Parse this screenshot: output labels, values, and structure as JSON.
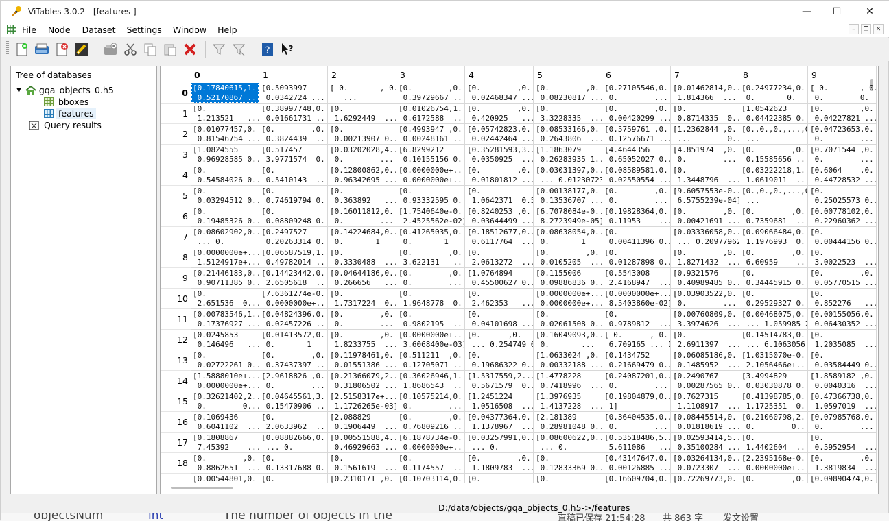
{
  "window": {
    "title": "ViTables 3.0.2 - [features     ]",
    "minimize": "—",
    "maximize": "☐",
    "close": "✕"
  },
  "menu": {
    "items": [
      "File",
      "Node",
      "Dataset",
      "Settings",
      "Window",
      "Help"
    ],
    "accel": [
      "F",
      "N",
      "D",
      "S",
      "W",
      "H"
    ]
  },
  "mdi_controls": {
    "minimize": "–",
    "restore": "❐",
    "close": "✕"
  },
  "toolbar": {
    "icons": [
      "new-file-icon",
      "open-file-icon",
      "close-file-icon",
      "edit-icon",
      "new-group-icon",
      "cut-icon",
      "copy-icon",
      "paste-icon",
      "delete-icon",
      "filter-icon",
      "filter-clear-icon",
      "help-icon",
      "whats-this-icon"
    ]
  },
  "tree": {
    "header": "Tree of databases",
    "file": "gqa_objects_0.h5",
    "children": [
      "bboxes",
      "features"
    ],
    "query": "Query results"
  },
  "table": {
    "columns": [
      "0",
      "1",
      "2",
      "3",
      "4",
      "5",
      "6",
      "7",
      "8",
      "9"
    ],
    "rows": [
      "0",
      "1",
      "2",
      "3",
      "4",
      "5",
      "6",
      "7",
      "8",
      "9",
      "10",
      "11",
      "12",
      "13",
      "14",
      "15",
      "16",
      "17",
      "18"
    ],
    "cells": [
      [
        "[0.17840615,1...\n 0.52170867 ...",
        "[0.5093997\n 0.0342724 ...",
        "[ 0.       , 0.\n   ...",
        "[0.        ,0.\n 0.39729667 ......",
        "[0.        ,0.\n 0.02468347 ......",
        "[0.        ,0.\n 0.08230817 ......",
        "[0.27105546,0.\n 0.        ...",
        "[0.01462814,0....\n 1.814366  ...",
        "[0.24977234,0....\n 0.       0.   ...",
        "[ 0.       , 0.\n 0.        0.   ..."
      ],
      [
        "[0.\n 1.213521   ...",
        "[0.38997748,0.\n 0.01661731 ......",
        "[0.\n 1.6292449  ...",
        "[0.01026754,1...\n 0.6172588  ...",
        "[0.        ,0.\n 0.420925   ...",
        "[0.\n 3.3228335  ...",
        "[0.        ,0.\n 0.00420299 ......",
        "[0.\n 0.8714335  0....",
        "[1.0542623\n 0.04422385 0....",
        "[0.        ,0.\n 0.04227821 ..."
      ],
      [
        "[0.01077457,0.\n 0.81546754 ......",
        "[0.        ,0.\n 0.3824439  ......",
        "[0.\n 0.00213907 0....",
        "[0.4993947 ,0.\n 0.00248161 ......",
        "[0.05742823,0.\n 0.02442464 ......",
        "[0.08533166,0.\n 0.2643806  ......",
        "[0.5759761 ,0.\n 0.12576671 ......",
        "[1.2362844 ,0.\n ...        0....",
        "[0.,0.,0.,...,0.,0.,\n ...",
        "[0.04723653,0.\n 0.        ..."
      ],
      [
        "[1.0824555\n 0.96928585 0....",
        "[0.517457\n 3.9771574  0....",
        "[0.03202028,4...\n 0.        ... 0.",
        "[6.8299212\n 0.10155156 0....",
        "[0.35281593,3...\n 0.0350925  ...",
        "[1.1863079\n 0.26283935 1....",
        "[4.4644356\n 0.65052027 0....",
        "[4.851974  ,0.\n 0.        ... 0....",
        "[0.        ,0.\n 0.15585656 ......",
        "[0.7071544 ,0.\n 0.        ..."
      ],
      [
        "[0.\n 0.54584026 0....",
        "[0.\n 0.5410143  ...",
        "[0.12800862,0....\n 0.96342695 ......",
        "[0.0000000e+...\n 0.0000000e+...",
        "[0.        ,0.\n 0.01801812 ......",
        "[0.03031397,0....\n ... 0.01230723...",
        "[0.08589581,0.\n 0.02550554 ......",
        "[0.\n 1.3448796  ...",
        "[0.03222218,1...\n 1.0619011  ...",
        "[0.6064    ,0.\n 0.44728532 ..."
      ],
      [
        "[0.\n 0.03294512 0....",
        "[0.\n 0.74619794 0....",
        "[0.\n 0.363892   ...",
        "[0.\n 0.93332595 0....",
        "[0.\n 1.0642371  0.5...",
        "[0.00138177,0.\n 0.13536707 ......",
        "[0.        ,0.\n 0.        ... 0....",
        "[9.6057553e-0...\n 6.5755239e-04]",
        "[0.,0.,0.,...,0.,0.,\n ...",
        "[0.\n 0.25025573 0..."
      ],
      [
        "[0.\n 0.19485326 0....",
        "[0.\n 0.08809248 0....",
        "[0.16011812,0.\n 0.        ...",
        "[1.7540640e-0...\n 2.4525562e-02]",
        "[0.8240253 ,0.\n 0.03644499 ......",
        "[6.7078084e-0...\n 8.2723949e-05]",
        "[0.19828364,0.\n 0.11953    ......",
        "[0.        ,0.\n 0.00421691 ......",
        "[0.        ,0.\n 0.7359681  ...",
        "[0.00778102,0.\n 0.22960362 ..."
      ],
      [
        "[0.08602902,0....\n ... 0.",
        "[0.2497527\n 0.20263314 0....",
        "[0.14224684,0....\n 0.       1",
        "[0.41265035,0....\n 0.       1",
        "[0.18512677,0....\n 0.6117764  ...",
        "[0.08638054,0....\n 0.       1",
        "[0.\n 0.00411396 0....",
        "[0.03336058,0....\n ... 0.20977962...",
        "[0.09066484,0....\n 1.1976993  0....",
        "[0.\n 0.00444156 0..."
      ],
      [
        "[0.0000000e+...\n 1.5124917e+...",
        "[0.06587519,1...\n 0.49782014 ......",
        "[0.\n 0.3330488  ...",
        "[0.        ,0.\n 3.622131   ...",
        "[0.\n 2.0613272  ...",
        "[0.        ,0.\n 0.0105205  ... ...",
        "[0.\n 0.01287898 0....",
        "[0.        ,0.\n 1.8271432  ...",
        "[0.        ,0.\n 6.60959    ...",
        "[0.\n 3.0022523  ..."
      ],
      [
        "[0.21446183,0....\n 0.90711385 0....",
        "[0.14423442,0.\n 2.6505618  ...",
        "[0.04644186,0....\n 0.266656   ...",
        "[0.        ,0.\n 0.        ...",
        "[1.0764894\n 0.45500627 0....",
        "[0.1155006\n 0.09886836 0....",
        "[0.5543008\n 2.4168947  ...",
        "[0.9321576\n 0.40989485 0....",
        "[0.\n 0.34445915 0....",
        "[0.        ,0.\n 0.05770515 ..."
      ],
      [
        "[0.\n 2.651536  0....",
        "[7.6361274e-0...\n 0.0000000e+...",
        "[0.\n 1.7317224  0....",
        "[0.\n 1.9648778  0....",
        "[0.\n 2.462353   ...",
        "[0.0000000e+...\n 0.0000000e+...",
        "[0.0000000e+...\n 8.5403860e-02]",
        "[0.03903522,0.\n 0.        ...",
        "[0.\n 0.29529327 0....",
        "[0.\n 0.852276   ..."
      ],
      [
        "[0.00783546,1...\n 0.17376927 ......",
        "[0.04824396,0.\n 0.02457226 ......",
        "[0.        ,0.\n 0.        ...",
        "[0.\n 0.9802195  ...",
        "[0.\n 0.04101698 ......",
        "[0.\n 0.02061508 0....",
        "[0.\n 0.9789812  ...",
        "[0.00760809,0.\n 3.3974626  ...",
        "[0.00468075,0....\n ... 1.059985 2...",
        "[0.00155056,0.\n 0.06430352 ..."
      ],
      [
        "[0.0245853\n 0.146496   ...",
        "[0.01413572,0....\n 0.       1",
        "[0.        ,0.\n 1.8233755  ......",
        "[0.0000000e+...\n 3.6068400e-03]",
        "[0.      ,0.      ,0.\n ... 0.254749 0....",
        "[0.16049093,0....\n 0.       ...",
        "[ 0.      , 0.     ,\n 6.709165 ... 14...",
        "[0.\n 2.6911397  ... ...",
        "[0.14514783,0....\n ... 6.1063056 ...",
        "[0.\n 1.2035085  ..."
      ],
      [
        "[0.\n 0.02722261 0....",
        "[0.        ,0.\n 0.37437397 ......",
        "[0.11978461,0.\n 0.01551386 ......",
        "[0.511211  ,0.\n 0.12705071 ......",
        "[0.\n 0.19686322 0....",
        "[1.0633024 ,0.\n 0.00332188 ......",
        "[0.1434752\n 0.21669479 0....",
        "[0.06085186,0.\n 0.1485952  ...",
        "[1.0315070e-0...\n 2.1056466e+...",
        "[0.\n 0.03584449 0..."
      ],
      [
        "[1.5888010e+...\n 0.0000000e+...",
        "[2.9618826 ,0.\n 0.        ...",
        "[0.21366079,2...\n 0.31806502 ......",
        "[0.36026946,1...\n 1.8686543  ...",
        "[1.5317559,2....\n 0.5671579  0....",
        "[1.4778228\n 0.7418996  ...",
        "[0.24087201,0....\n 0.        ...",
        "[0.2490767\n 0.00287565 0....",
        "[3.4994829\n 0.03030878 0....",
        "[1.8589182 ,0.\n 0.0040316  ..."
      ],
      [
        "[0.32621402,2...\n 0.        0....",
        "[0.04645561,3...\n 0.15470906 ......",
        "[2.5158317e+...\n 1.1726265e-03]",
        "[0.10575214,0.\n 0.        ...",
        "[1.2451224\n 1.0516508  ...",
        "[1.3976935\n 1.4137228  ...",
        "[0.19804879,0....\n 1]",
        "[0.7627315\n 1.1108917  ...",
        "[0.41398785,0....\n 1.1725351  0....",
        "[0.47366738,0.\n 1.0597019  ..."
      ],
      [
        "[0.1069436\n 0.6041102  ...",
        "[0.\n 2.0633962  ...",
        "[2.088829\n 0.1906449  ...",
        "[0.        ,0.\n 0.76809216 ......",
        "[0.04377364,0.\n 1.1378967  ...",
        "[2.181389\n 0.28981048 0....",
        "[0.36404535,0....\n 0.        ...",
        "[0.08445514,0.\n 0.01818619 ......",
        "[0.21060798,2...\n 0.        0....",
        "[0.07985768,0.\n 0.        ..."
      ],
      [
        "[0.1808867\n 7.45392    ...",
        "[0.08882666,0....\n ... 0.",
        "[0.00551588,4...\n 0.46929663 ......",
        "[6.1878734e-0...\n 0.0000000e+...",
        "[0.03257991,0....\n ... 0.",
        "[0.08600622,0....\n ... 0.",
        "[0.53518486,5...\n 5.611086   ...",
        "[0.02593414,5...\n 0.35100284 ......",
        "[0.\n 1.4402604  ...",
        "[0.\n 0.5952954  ..."
      ],
      [
        "[0.        ,0.\n 0.8862651  ...",
        "[0.\n 0.13317688 0....",
        "[0.\n 0.1561619  ...",
        "[0.\n 0.1174557  ...",
        "[0.        ,0.\n 1.1809783  ...",
        "[0.\n 0.12833369 0....",
        "[0.43147647,0.\n 0.00126885 ......",
        "[0.03264134,0....\n 0.0723307  ...",
        "[2.2395168e-0...\n 0.0000000e+...",
        "[0.        ,0.\n 1.3819834  ..."
      ]
    ],
    "partial_row": [
      "[0.00544801,0.",
      "[0.",
      "[0.2310171 ,0.",
      "[0.10703114,0.",
      "[0.",
      "[0.",
      "[0.16609704,0.",
      "[0.72269773,0.",
      "[0.        ,0.",
      "[0.09890474,0."
    ]
  },
  "status": {
    "path": "D:/data/objects/gqa_objects_0.h5->/features"
  },
  "background_text": [
    "objectsNum",
    "int",
    "The number of objects in the",
    "直稿已保存 21:54:28",
    "共 863 字",
    "发文设置"
  ]
}
